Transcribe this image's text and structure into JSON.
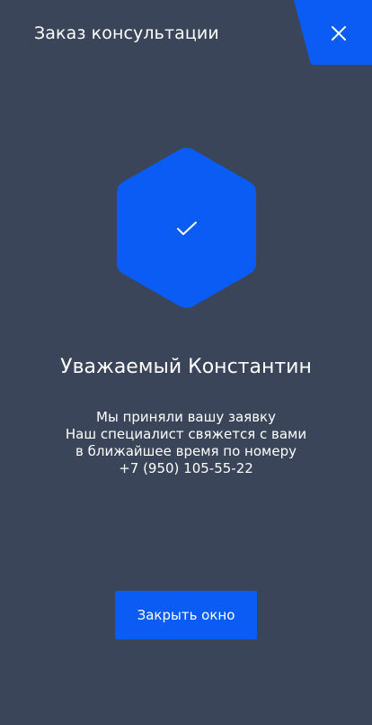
{
  "header": {
    "title": "Заказ консультации",
    "close_icon": "close-icon"
  },
  "status": {
    "icon": "checkmark-icon"
  },
  "content": {
    "greeting": "Уважаемый Константин",
    "message_lines": [
      "Мы приняли вашу заявку",
      "Наш специалист свяжется с вами",
      "в ближайшее время по номеру",
      "+7 (950) 105-55-22"
    ]
  },
  "actions": {
    "close_window_label": "Закрыть окно"
  },
  "colors": {
    "background": "#3a4559",
    "accent": "#0a5cf5",
    "text": "#ffffff"
  }
}
